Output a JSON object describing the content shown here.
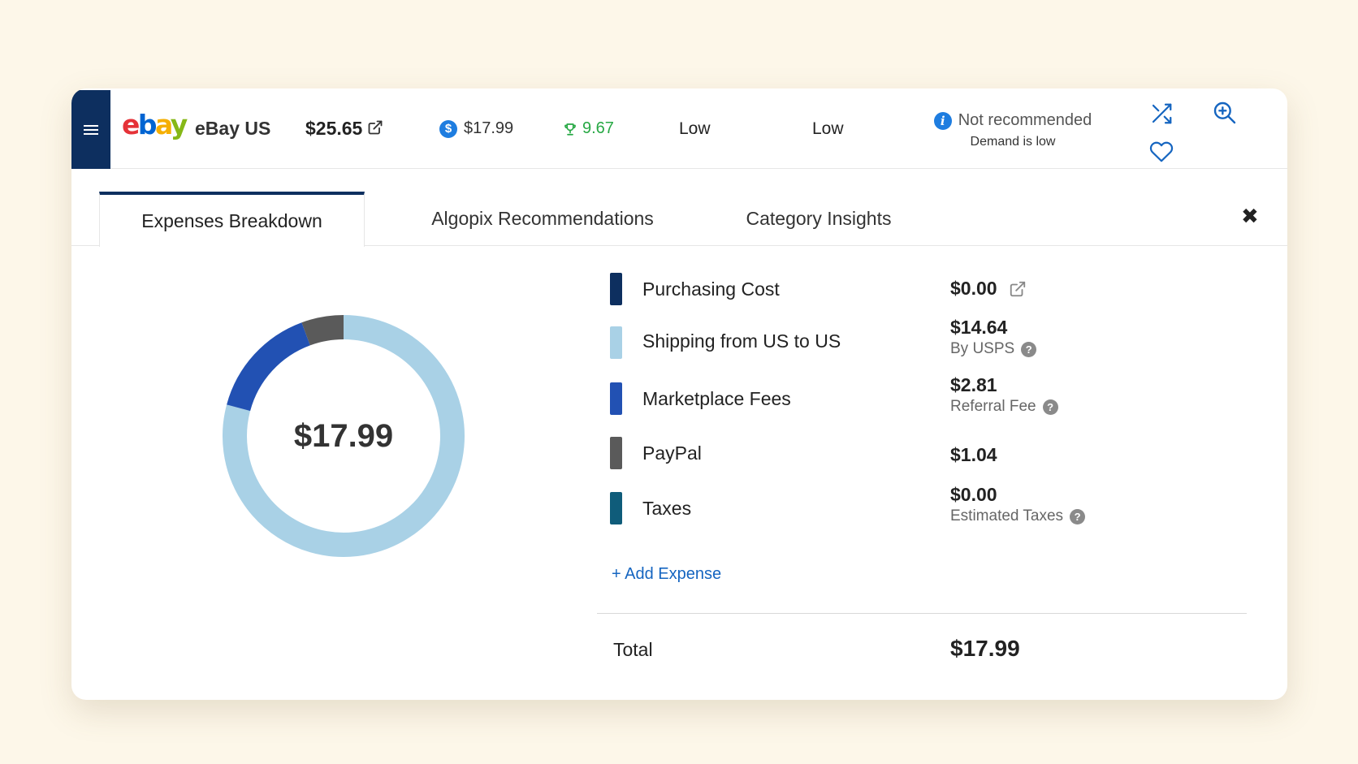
{
  "header": {
    "logo": {
      "e": "e",
      "b": "b",
      "a": "a",
      "y": "y"
    },
    "marketplace": "eBay US",
    "price": "$25.65",
    "cost": "$17.99",
    "cost_icon_glyph": "$",
    "profit": "9.67",
    "level_1": "Low",
    "level_2": "Low",
    "recommendation": "Not recommended",
    "recommendation_note": "Demand is low",
    "info_glyph": "i"
  },
  "tabs": [
    {
      "label": "Expenses Breakdown",
      "active": true
    },
    {
      "label": "Algopix Recommendations",
      "active": false
    },
    {
      "label": "Category Insights",
      "active": false
    }
  ],
  "close_glyph": "✖",
  "donut": {
    "center_label": "$17.99"
  },
  "chart_data": {
    "type": "pie",
    "categories": [
      "Purchasing Cost",
      "Shipping from US to US",
      "Marketplace Fees",
      "PayPal",
      "Taxes"
    ],
    "values": [
      0.0,
      14.64,
      2.81,
      1.04,
      0.0
    ],
    "colors": [
      "#0d2f5f",
      "#a9d1e6",
      "#2251b3",
      "#5a5a5a",
      "#0f5c7a"
    ]
  },
  "expenses": [
    {
      "label": "Purchasing Cost",
      "value": "$0.00",
      "sub": "",
      "color": "#0d2f5f"
    },
    {
      "label": "Shipping from US to US",
      "value": "$14.64",
      "sub": "By USPS",
      "color": "#a9d1e6"
    },
    {
      "label": "Marketplace Fees",
      "value": "$2.81",
      "sub": "Referral Fee",
      "color": "#2251b3"
    },
    {
      "label": "PayPal",
      "value": "$1.04",
      "sub": "",
      "color": "#5a5a5a"
    },
    {
      "label": "Taxes",
      "value": "$0.00",
      "sub": "Estimated Taxes",
      "color": "#0f5c7a"
    }
  ],
  "help_glyph": "?",
  "add_expense_label": "+ Add Expense",
  "total": {
    "label": "Total",
    "value": "$17.99"
  }
}
